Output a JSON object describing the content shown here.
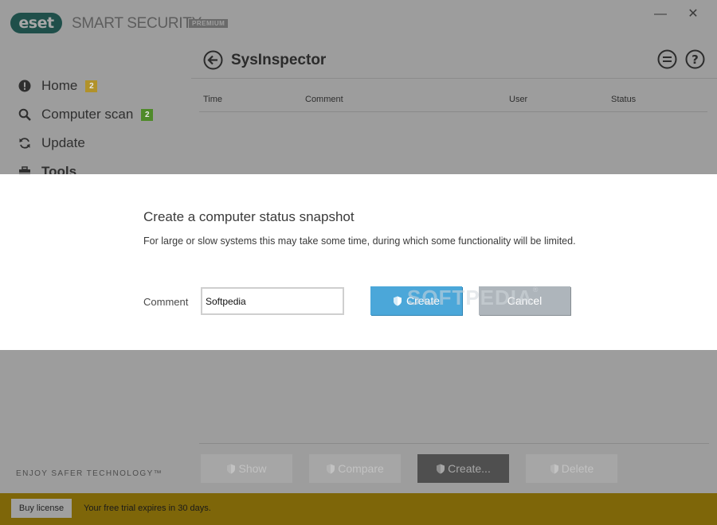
{
  "header": {
    "logo_text": "eset",
    "brand": "SMART SECURITY",
    "edition": "PREMIUM",
    "minimize_glyph": "—",
    "close_glyph": "✕"
  },
  "sidebar": {
    "items": [
      {
        "label": "Home",
        "icon": "alert-circle-icon",
        "badge": "2",
        "badge_color": "#b1922a"
      },
      {
        "label": "Computer scan",
        "icon": "magnifier-icon",
        "badge": "2",
        "badge_color": "#4f8a2a"
      },
      {
        "label": "Update",
        "icon": "refresh-icon"
      },
      {
        "label": "Tools",
        "icon": "toolbox-icon"
      }
    ],
    "tagline": "ENJOY SAFER TECHNOLOGY™"
  },
  "page": {
    "title": "SysInspector",
    "back_icon": "back-arrow-icon",
    "menu_icon": "menu-icon",
    "help_icon": "help-icon"
  },
  "table": {
    "columns": [
      "Time",
      "Comment",
      "User",
      "Status"
    ],
    "rows": []
  },
  "actions": {
    "show": "Show",
    "compare": "Compare",
    "create": "Create...",
    "delete": "Delete"
  },
  "statusbar": {
    "buy_label": "Buy license",
    "trial_text": "Your free trial expires in 30 days."
  },
  "dialog": {
    "title": "Create a computer status snapshot",
    "description": "For large or slow systems this may take some time, during which some functionality will be limited.",
    "comment_label": "Comment",
    "comment_value": "Softpedia",
    "create_label": "Create",
    "cancel_label": "Cancel",
    "accent_color": "#4ba7d9"
  },
  "watermark": {
    "text": "SOFTPEDIA",
    "mark": "®"
  }
}
